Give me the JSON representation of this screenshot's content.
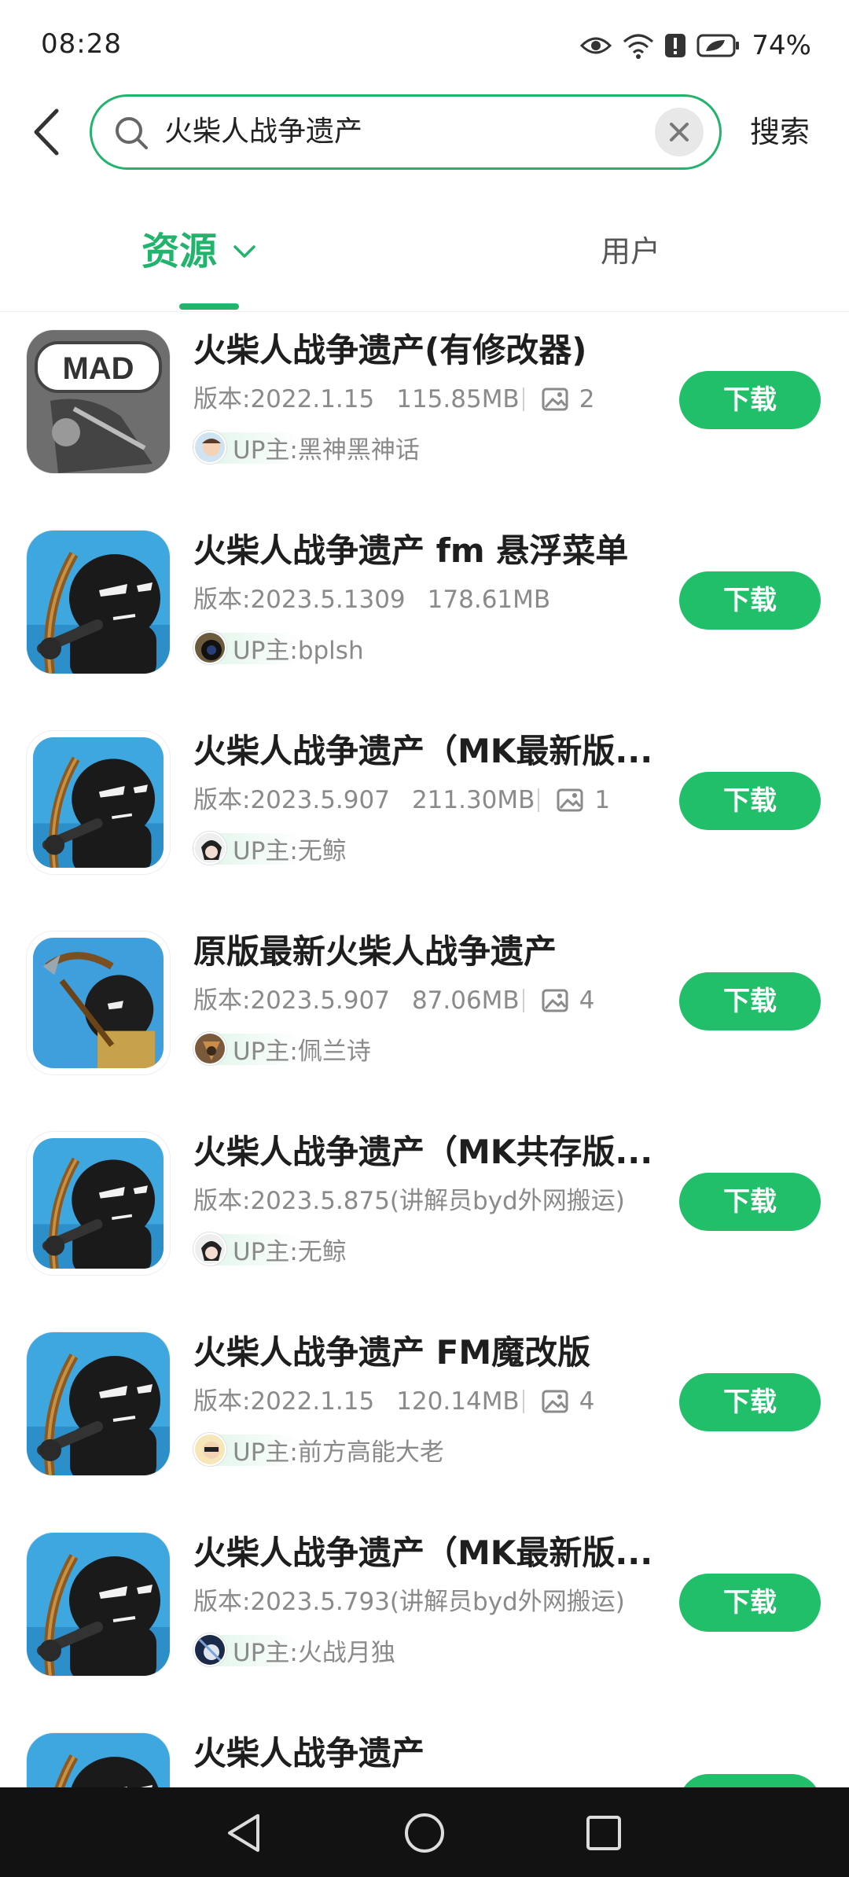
{
  "status_bar": {
    "time": "08:28",
    "battery": "74%"
  },
  "search": {
    "query": "火柴人战争遗产",
    "action_label": "搜索"
  },
  "tabs": [
    {
      "label": "资源",
      "active": true
    },
    {
      "label": "用户",
      "active": false
    }
  ],
  "theme": {
    "accent": "#22b46c",
    "button": "#22bf6b"
  },
  "items": [
    {
      "title": "火柴人战争遗产(有修改器)",
      "version": "版本:2022.1.15",
      "size": "115.85MB",
      "image_count": "2",
      "uploader": "UP主:黑神黑神话",
      "download_label": "下载"
    },
    {
      "title": "火柴人战争遗产 fm 悬浮菜单",
      "version": "版本:2023.5.1309",
      "size": "178.61MB",
      "image_count": "",
      "uploader": "UP主:bplsh",
      "download_label": "下载"
    },
    {
      "title": "火柴人战争遗产（MK最新版...",
      "version": "版本:2023.5.907",
      "size": "211.30MB",
      "image_count": "1",
      "uploader": "UP主:无鲸",
      "download_label": "下载"
    },
    {
      "title": "原版最新火柴人战争遗产",
      "version": "版本:2023.5.907",
      "size": "87.06MB",
      "image_count": "4",
      "uploader": "UP主:佩兰诗",
      "download_label": "下载"
    },
    {
      "title": "火柴人战争遗产（MK共存版...",
      "version": "版本:2023.5.875(讲解员byd外网搬运)",
      "size": "",
      "image_count": "",
      "uploader": "UP主:无鲸",
      "download_label": "下载"
    },
    {
      "title": "火柴人战争遗产 FM魔改版",
      "version": "版本:2022.1.15",
      "size": "120.14MB",
      "image_count": "4",
      "uploader": "UP主:前方高能大老",
      "download_label": "下载"
    },
    {
      "title": "火柴人战争遗产（MK最新版...",
      "version": "版本:2023.5.793(讲解员byd外网搬运)",
      "size": "",
      "image_count": "",
      "uploader": "UP主:火战月独",
      "download_label": "下载"
    },
    {
      "title": "火柴人战争遗产",
      "version": "",
      "size": "",
      "image_count": "",
      "uploader": "",
      "download_label": ""
    }
  ],
  "icons": {
    "back": "chevron-left-icon",
    "search": "search-icon",
    "clear": "close-icon",
    "dropdown": "chevron-down-icon",
    "image": "image-icon",
    "nav": [
      "nav-back-icon",
      "nav-home-icon",
      "nav-recents-icon"
    ]
  }
}
